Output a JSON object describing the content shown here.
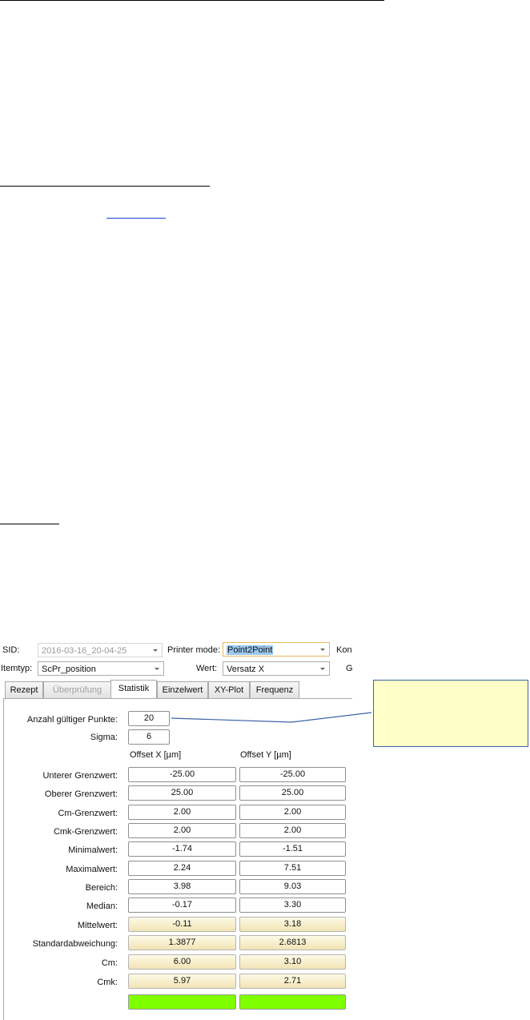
{
  "header": {
    "sid_label": "SID:",
    "sid_value": "2016-03-16_20-04-25",
    "printer_mode_label": "Printer mode:",
    "printer_mode_value": "Point2Point",
    "ko_label": "Kon",
    "itemtyp_label": "Itemtyp:",
    "itemtyp_value": "ScPr_position",
    "wert_label": "Wert:",
    "wert_value": "Versatz X",
    "g_label": "G"
  },
  "tabs": [
    {
      "label": "Rezept",
      "state": "normal"
    },
    {
      "label": "Überprüfung",
      "state": "disabled"
    },
    {
      "label": "Statistik",
      "state": "active"
    },
    {
      "label": "Einzelwert",
      "state": "normal"
    },
    {
      "label": "XY-Plot",
      "state": "normal"
    },
    {
      "label": "Frequenz",
      "state": "normal"
    }
  ],
  "stats": {
    "anzahl_label": "Anzahl gültiger Punkte:",
    "anzahl_value": "20",
    "sigma_label": "Sigma:",
    "sigma_value": "6",
    "col_x": "Offset X [µm]",
    "col_y": "Offset Y [µm]",
    "rows": [
      {
        "label": "Unterer Grenzwert:",
        "x": "-25.00",
        "y": "-25.00",
        "style": "plain"
      },
      {
        "label": "Oberer Grenzwert:",
        "x": "25.00",
        "y": "25.00",
        "style": "plain"
      },
      {
        "label": "Cm-Grenzwert:",
        "x": "2.00",
        "y": "2.00",
        "style": "plain"
      },
      {
        "label": "Cmk-Grenzwert:",
        "x": "2.00",
        "y": "2.00",
        "style": "plain"
      },
      {
        "label": "Minimalwert:",
        "x": "-1.74",
        "y": "-1.51",
        "style": "plain"
      },
      {
        "label": "Maximalwert:",
        "x": "2.24",
        "y": "7.51",
        "style": "plain"
      },
      {
        "label": "Bereich:",
        "x": "3.98",
        "y": "9.03",
        "style": "plain"
      },
      {
        "label": "Median:",
        "x": "-0.17",
        "y": "3.30",
        "style": "plain"
      },
      {
        "label": "Mittelwert:",
        "x": "-0.11",
        "y": "3.18",
        "style": "warn"
      },
      {
        "label": "Standardabweichung:",
        "x": "1.3877",
        "y": "2.6813",
        "style": "warn"
      },
      {
        "label": "Cm:",
        "x": "6.00",
        "y": "3.10",
        "style": "warn"
      },
      {
        "label": "Cmk:",
        "x": "5.97",
        "y": "2.71",
        "style": "warn"
      }
    ],
    "cmk_indicator": {
      "x": "",
      "y": "",
      "color": "#7fff00"
    }
  },
  "annotation": {
    "text": ""
  },
  "colors": {
    "focus_border": "#e5b95a",
    "selection": "#99c9ef",
    "note_fill": "#ffffc9",
    "note_border": "#3c63a8",
    "ok_green": "#7fff00"
  }
}
